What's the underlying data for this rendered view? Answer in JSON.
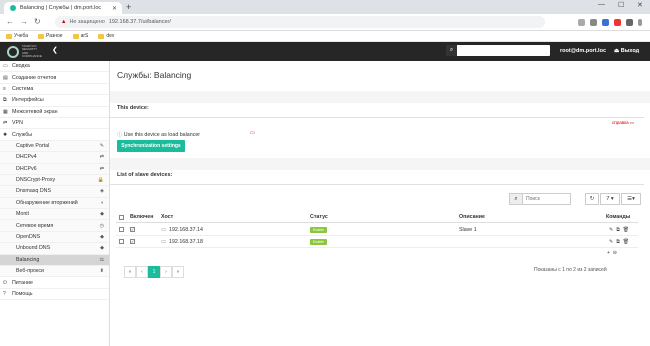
{
  "browser": {
    "tab_title": "Balancing | Службы | dm.port.loc",
    "security": "Не защищено",
    "url": "192.168.37.7/ui/balancer/",
    "bookmarks": [
      "Учеба",
      "Разное",
      "arS",
      "dev"
    ]
  },
  "header": {
    "logo_text": "TANDYCO\nSECURITY\nAND\nCOMPLIANCE",
    "search_placeholder": "",
    "user": "root@dm.port.loc",
    "logout": "Выход"
  },
  "sidebar": {
    "items": [
      {
        "label": "Сводка",
        "icon": "▭"
      },
      {
        "label": "Создание отчетов",
        "icon": "▤"
      },
      {
        "label": "Система",
        "icon": "≡"
      },
      {
        "label": "Интерфейсы",
        "icon": "⧉"
      },
      {
        "label": "Межсетевой экран",
        "icon": "▦"
      },
      {
        "label": "VPN",
        "icon": "⇄"
      },
      {
        "label": "Службы",
        "icon": "✹"
      }
    ],
    "sub_items": [
      {
        "label": "Captive Portal",
        "icon": "✎"
      },
      {
        "label": "DHCPv4",
        "icon": "⇄"
      },
      {
        "label": "DHCPv6",
        "icon": "⇄"
      },
      {
        "label": "DNSCrypt-Proxy",
        "icon": "🔒"
      },
      {
        "label": "Dnsmasq DNS",
        "icon": "◈"
      },
      {
        "label": "Обнаружение вторжений",
        "icon": "◐"
      },
      {
        "label": "Monit",
        "icon": "◆"
      },
      {
        "label": "Сетевое время",
        "icon": "◷"
      },
      {
        "label": "OpenDNS",
        "icon": "◆"
      },
      {
        "label": "Unbound DNS",
        "icon": "◆"
      },
      {
        "label": "Balancing",
        "icon": "⚖"
      },
      {
        "label": "Веб-прокси",
        "icon": "⬍"
      }
    ],
    "bottom_items": [
      {
        "label": "Питание",
        "icon": "⏻"
      },
      {
        "label": "Помощь",
        "icon": "?"
      }
    ]
  },
  "main": {
    "title": "Службы: Balancing",
    "this_device": "This device:",
    "help": "справка",
    "use_label": "Use this device as load balancer",
    "sync_button": "Synchronization settings",
    "list_title": "List of slave devices:",
    "search_placeholder": "Поиск",
    "page_size": "7",
    "columns": [
      "Включен",
      "Хост",
      "Статус",
      "Описание",
      "Команды"
    ],
    "rows": [
      {
        "host": "192.168.37.14",
        "status": "Enable",
        "desc": "Slave 1"
      },
      {
        "host": "192.168.37.18",
        "status": "Enable",
        "desc": ""
      }
    ],
    "pager": [
      "«",
      "‹",
      "1",
      "›",
      "»"
    ],
    "page_info": "Показаны с 1 по 2 из 2 записей"
  },
  "colors": {
    "accent": "#1abc9c",
    "header": "#262626",
    "status_ok": "#8cc63f"
  }
}
